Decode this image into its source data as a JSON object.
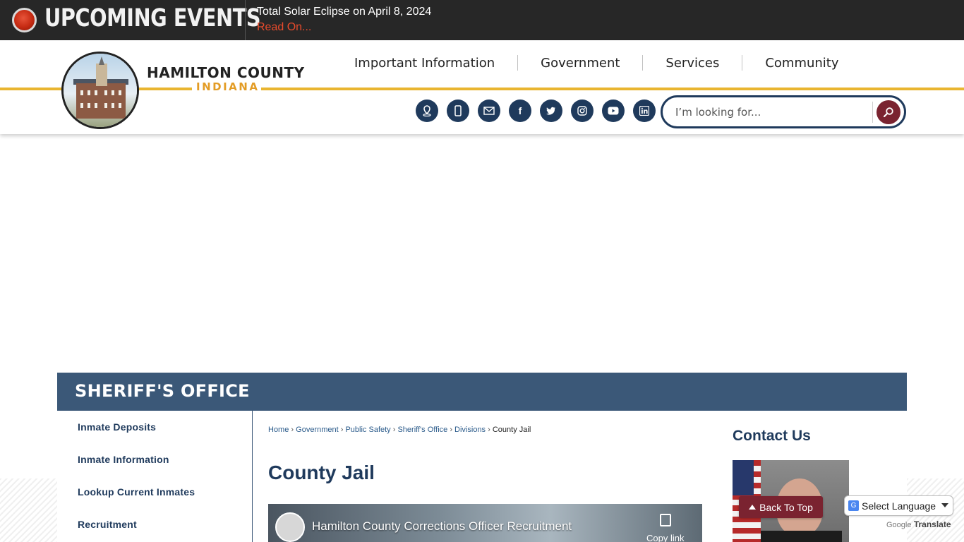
{
  "events": {
    "title": "UPCOMING EVENTS",
    "headline": "Total Solar Eclipse on April 8, 2024",
    "read_on": "Read On..."
  },
  "brand": {
    "name": "HAMILTON COUNTY",
    "sub": "INDIANA"
  },
  "nav": {
    "items": [
      "Important Information",
      "Government",
      "Services",
      "Community"
    ]
  },
  "social": {
    "icons": [
      "map-pin-icon",
      "mobile-phone-icon",
      "email-icon",
      "facebook-icon",
      "twitter-icon",
      "instagram-icon",
      "youtube-icon",
      "linkedin-icon"
    ]
  },
  "search": {
    "placeholder": "I’m looking for..."
  },
  "department": {
    "title": "SHERIFF'S OFFICE"
  },
  "side_nav": {
    "items": [
      "Inmate Deposits",
      "Inmate Information",
      "Lookup Current Inmates",
      "Recruitment"
    ]
  },
  "breadcrumb": {
    "items": [
      "Home",
      "Government",
      "Public Safety",
      "Sheriff's Office",
      "Divisions"
    ],
    "current": "County Jail",
    "separator": "›"
  },
  "page": {
    "title": "County Jail"
  },
  "video": {
    "title": "Hamilton County Corrections Officer Recruitment",
    "copy_label": "Copy link"
  },
  "contact": {
    "title": "Contact Us"
  },
  "back_to_top": "Back To Top",
  "translate": {
    "select_label": "Select Language",
    "powered_by": "Google",
    "translate_label": "Translate"
  },
  "colors": {
    "navy": "#1f3a5c",
    "banner": "#3b5878",
    "gold": "#e9b530",
    "maroon": "#7a2330",
    "alert_red": "#e84b2c"
  }
}
